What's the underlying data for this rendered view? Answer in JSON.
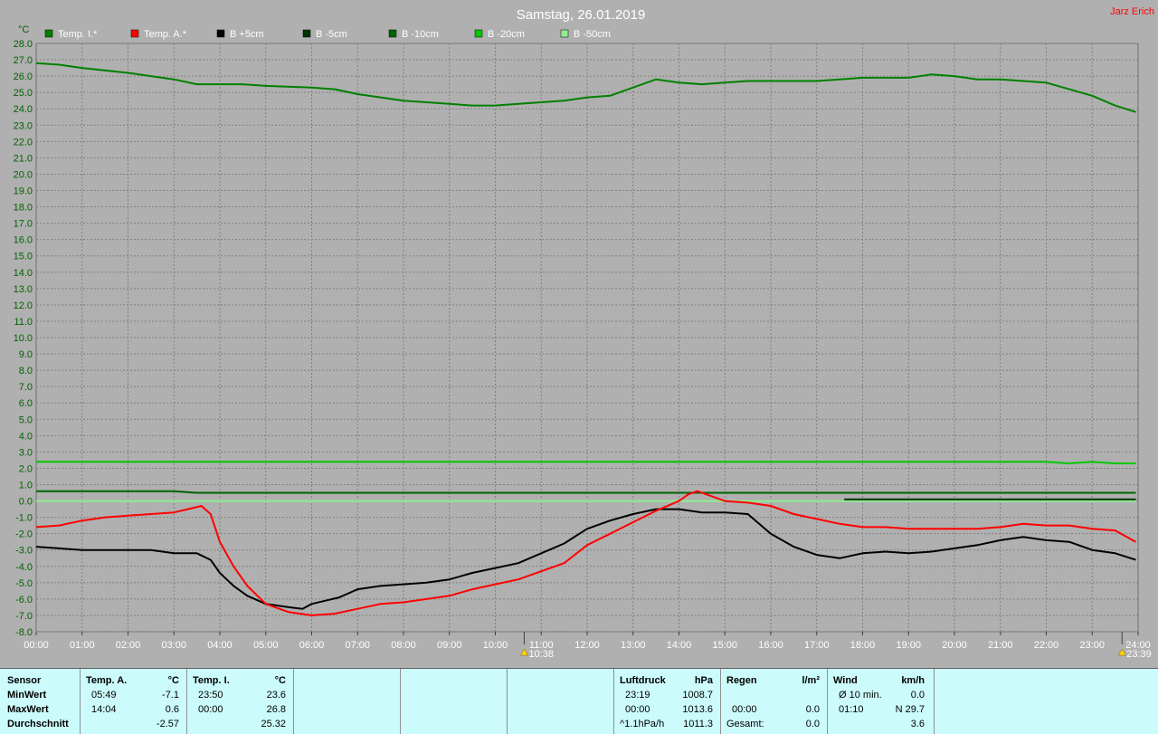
{
  "title": "Samstag, 26.01.2019",
  "author": "Jarz Erich",
  "colors": {
    "background": "#b0b0b0",
    "axis_text": "#006400",
    "grid": "#808080"
  },
  "chart_data": {
    "type": "line",
    "ylabel": "°C",
    "ylim": [
      -8,
      28
    ],
    "y_ticks": [
      "28.0",
      "27.0",
      "26.0",
      "25.0",
      "24.0",
      "23.0",
      "22.0",
      "21.0",
      "20.0",
      "19.0",
      "18.0",
      "17.0",
      "16.0",
      "15.0",
      "14.0",
      "13.0",
      "12.0",
      "11.0",
      "10.0",
      "9.0",
      "8.0",
      "7.0",
      "6.0",
      "5.0",
      "4.0",
      "3.0",
      "2.0",
      "1.0",
      "0.0",
      "-1.0",
      "-2.0",
      "-3.0",
      "-4.0",
      "-5.0",
      "-6.0",
      "-7.0",
      "-8.0"
    ],
    "xlim": [
      0,
      24
    ],
    "x_ticks": [
      "00:00",
      "01:00",
      "02:00",
      "03:00",
      "04:00",
      "05:00",
      "06:00",
      "07:00",
      "08:00",
      "09:00",
      "10:00",
      "11:00",
      "12:00",
      "13:00",
      "14:00",
      "15:00",
      "16:00",
      "17:00",
      "18:00",
      "19:00",
      "20:00",
      "21:00",
      "22:00",
      "23:00",
      "24:00"
    ],
    "grid": true,
    "legend_position": "top-left",
    "annotations": [
      {
        "x": 10.63,
        "text": "10:38",
        "icon": "sunrise-icon"
      },
      {
        "x": 23.65,
        "text": "23:39",
        "icon": "moonset-icon"
      }
    ],
    "series": [
      {
        "name": "Temp. I.*",
        "color": "#008000",
        "points": [
          [
            0,
            26.8
          ],
          [
            0.5,
            26.7
          ],
          [
            1,
            26.5
          ],
          [
            2,
            26.2
          ],
          [
            3,
            25.8
          ],
          [
            3.5,
            25.5
          ],
          [
            4,
            25.5
          ],
          [
            4.5,
            25.5
          ],
          [
            5,
            25.4
          ],
          [
            6,
            25.3
          ],
          [
            6.5,
            25.2
          ],
          [
            7,
            24.9
          ],
          [
            7.5,
            24.7
          ],
          [
            8,
            24.5
          ],
          [
            8.5,
            24.4
          ],
          [
            9,
            24.3
          ],
          [
            9.5,
            24.2
          ],
          [
            10,
            24.2
          ],
          [
            10.5,
            24.3
          ],
          [
            11,
            24.4
          ],
          [
            11.5,
            24.5
          ],
          [
            12,
            24.7
          ],
          [
            12.5,
            24.8
          ],
          [
            13,
            25.3
          ],
          [
            13.5,
            25.8
          ],
          [
            14,
            25.6
          ],
          [
            14.5,
            25.5
          ],
          [
            15,
            25.6
          ],
          [
            15.5,
            25.7
          ],
          [
            16,
            25.7
          ],
          [
            16.5,
            25.7
          ],
          [
            17,
            25.7
          ],
          [
            17.5,
            25.8
          ],
          [
            18,
            25.9
          ],
          [
            18.5,
            25.9
          ],
          [
            19,
            25.9
          ],
          [
            19.5,
            26.1
          ],
          [
            20,
            26.0
          ],
          [
            20.5,
            25.8
          ],
          [
            21,
            25.8
          ],
          [
            21.5,
            25.7
          ],
          [
            22,
            25.6
          ],
          [
            22.5,
            25.2
          ],
          [
            23,
            24.8
          ],
          [
            23.5,
            24.2
          ],
          [
            23.95,
            23.8
          ]
        ]
      },
      {
        "name": "Temp. A.*",
        "color": "#ff0000",
        "points": [
          [
            0,
            -1.6
          ],
          [
            0.5,
            -1.5
          ],
          [
            1,
            -1.2
          ],
          [
            1.5,
            -1.0
          ],
          [
            2,
            -0.9
          ],
          [
            2.5,
            -0.8
          ],
          [
            3,
            -0.7
          ],
          [
            3.3,
            -0.5
          ],
          [
            3.6,
            -0.3
          ],
          [
            3.8,
            -0.8
          ],
          [
            4,
            -2.5
          ],
          [
            4.3,
            -4.0
          ],
          [
            4.6,
            -5.2
          ],
          [
            5,
            -6.3
          ],
          [
            5.5,
            -6.8
          ],
          [
            6,
            -7.0
          ],
          [
            6.5,
            -6.9
          ],
          [
            7,
            -6.6
          ],
          [
            7.5,
            -6.3
          ],
          [
            8,
            -6.2
          ],
          [
            8.5,
            -6.0
          ],
          [
            9,
            -5.8
          ],
          [
            9.5,
            -5.4
          ],
          [
            10,
            -5.1
          ],
          [
            10.5,
            -4.8
          ],
          [
            11,
            -4.3
          ],
          [
            11.5,
            -3.8
          ],
          [
            12,
            -2.7
          ],
          [
            12.5,
            -2.0
          ],
          [
            13,
            -1.3
          ],
          [
            13.5,
            -0.6
          ],
          [
            14,
            0.0
          ],
          [
            14.2,
            0.4
          ],
          [
            14.4,
            0.6
          ],
          [
            14.7,
            0.3
          ],
          [
            15,
            0.0
          ],
          [
            15.5,
            -0.1
          ],
          [
            16,
            -0.3
          ],
          [
            16.5,
            -0.8
          ],
          [
            17,
            -1.1
          ],
          [
            17.5,
            -1.4
          ],
          [
            18,
            -1.6
          ],
          [
            18.5,
            -1.6
          ],
          [
            19,
            -1.7
          ],
          [
            19.5,
            -1.7
          ],
          [
            20,
            -1.7
          ],
          [
            20.5,
            -1.7
          ],
          [
            21,
            -1.6
          ],
          [
            21.5,
            -1.4
          ],
          [
            22,
            -1.5
          ],
          [
            22.5,
            -1.5
          ],
          [
            23,
            -1.7
          ],
          [
            23.5,
            -1.8
          ],
          [
            23.95,
            -2.5
          ]
        ]
      },
      {
        "name": "B +5cm",
        "color": "#000000",
        "points": [
          [
            0,
            -2.8
          ],
          [
            0.5,
            -2.9
          ],
          [
            1,
            -3.0
          ],
          [
            1.5,
            -3.0
          ],
          [
            2,
            -3.0
          ],
          [
            2.5,
            -3.0
          ],
          [
            3,
            -3.2
          ],
          [
            3.5,
            -3.2
          ],
          [
            3.8,
            -3.6
          ],
          [
            4,
            -4.4
          ],
          [
            4.3,
            -5.2
          ],
          [
            4.6,
            -5.8
          ],
          [
            5,
            -6.3
          ],
          [
            5.5,
            -6.5
          ],
          [
            5.8,
            -6.6
          ],
          [
            6,
            -6.3
          ],
          [
            6.3,
            -6.1
          ],
          [
            6.6,
            -5.9
          ],
          [
            7,
            -5.4
          ],
          [
            7.5,
            -5.2
          ],
          [
            8,
            -5.1
          ],
          [
            8.5,
            -5.0
          ],
          [
            9,
            -4.8
          ],
          [
            9.5,
            -4.4
          ],
          [
            10,
            -4.1
          ],
          [
            10.5,
            -3.8
          ],
          [
            11,
            -3.2
          ],
          [
            11.5,
            -2.6
          ],
          [
            12,
            -1.7
          ],
          [
            12.5,
            -1.2
          ],
          [
            13,
            -0.8
          ],
          [
            13.5,
            -0.5
          ],
          [
            14,
            -0.5
          ],
          [
            14.5,
            -0.7
          ],
          [
            15,
            -0.7
          ],
          [
            15.5,
            -0.8
          ],
          [
            16,
            -2.0
          ],
          [
            16.5,
            -2.8
          ],
          [
            17,
            -3.3
          ],
          [
            17.5,
            -3.5
          ],
          [
            18,
            -3.2
          ],
          [
            18.5,
            -3.1
          ],
          [
            19,
            -3.2
          ],
          [
            19.5,
            -3.1
          ],
          [
            20,
            -2.9
          ],
          [
            20.5,
            -2.7
          ],
          [
            21,
            -2.4
          ],
          [
            21.5,
            -2.2
          ],
          [
            22,
            -2.4
          ],
          [
            22.5,
            -2.5
          ],
          [
            23,
            -3.0
          ],
          [
            23.5,
            -3.2
          ],
          [
            23.95,
            -3.6
          ]
        ]
      },
      {
        "name": "B -5cm",
        "color": "#003300",
        "points": [
          [
            17.6,
            0.1
          ],
          [
            23.95,
            0.1
          ]
        ]
      },
      {
        "name": "B -10cm",
        "color": "#006400",
        "points": [
          [
            0,
            0.6
          ],
          [
            3,
            0.6
          ],
          [
            3.5,
            0.5
          ],
          [
            7,
            0.5
          ],
          [
            14,
            0.5
          ],
          [
            23.95,
            0.5
          ]
        ]
      },
      {
        "name": "B -20cm",
        "color": "#00c800",
        "points": [
          [
            0,
            2.4
          ],
          [
            22,
            2.4
          ],
          [
            22.5,
            2.3
          ],
          [
            23,
            2.4
          ],
          [
            23.5,
            2.3
          ],
          [
            23.95,
            2.3
          ]
        ]
      },
      {
        "name": "B -50cm",
        "color": "#90ee90",
        "points": [
          [
            0,
            0.0
          ],
          [
            23.95,
            0.0
          ]
        ]
      }
    ]
  },
  "stats": {
    "headers": {
      "sensor": "Sensor",
      "temp_a": "Temp. A.",
      "temp_a_unit": "°C",
      "temp_i": "Temp. I.",
      "temp_i_unit": "°C",
      "pressure": "Luftdruck",
      "pressure_unit": "hPa",
      "rain": "Regen",
      "rain_unit": "l/m²",
      "wind": "Wind",
      "wind_unit": "km/h"
    },
    "rows": {
      "min_label": "MinWert",
      "max_label": "MaxWert",
      "avg_label": "Durchschnitt"
    },
    "temp_a": {
      "min_time": "05:49",
      "min_val": "-7.1",
      "max_time": "14:04",
      "max_val": "0.6",
      "avg": "-2.57"
    },
    "temp_i": {
      "min_time": "23:50",
      "min_val": "23.6",
      "max_time": "00:00",
      "max_val": "26.8",
      "avg": "25.32"
    },
    "pressure": {
      "min_time": "23:19",
      "min_val": "1008.7",
      "max_time": "00:00",
      "max_val": "1013.6",
      "trend": "^1.1hPa/h",
      "avg": "1011.3"
    },
    "rain": {
      "time": "00:00",
      "val": "0.0",
      "total_label": "Gesamt:",
      "total": "0.0"
    },
    "wind": {
      "avg_label": "Ø 10 min.",
      "avg": "0.0",
      "max_time": "01:10",
      "max_val": "N 29.7",
      "avg_day": "3.6"
    }
  }
}
